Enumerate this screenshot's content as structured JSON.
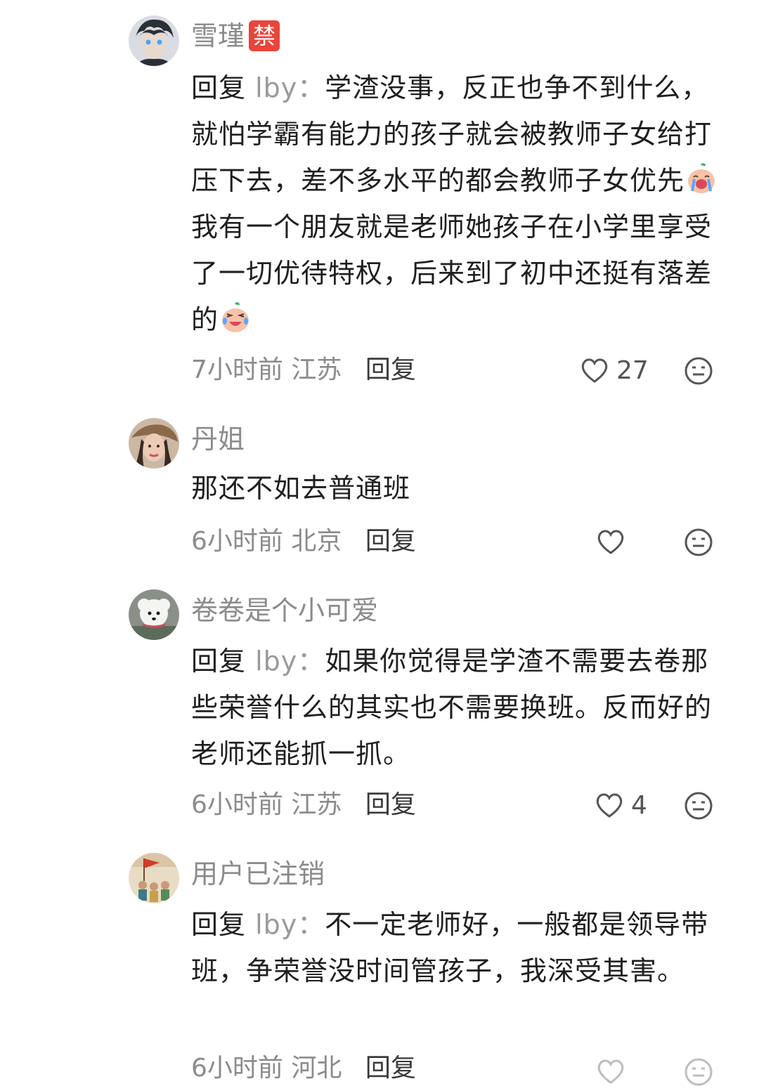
{
  "comments": [
    {
      "username": "雪瑾",
      "badge": "禁",
      "reply_prefix": "回复",
      "reply_target": "lby：",
      "text_a": "学渣没事，反正也争不到什么，就怕学霸有能力的孩子就会被教师子女给打压下去，差不多水平的都会教师子女优先",
      "text_b": "我有一个朋友就是老师她孩子在小学里享受了一切优待特权，后来到了初中还挺有落差的",
      "time": "7小时前",
      "location": "江苏",
      "reply_label": "回复",
      "likes": "27",
      "emojis": [
        "crying-face-icon",
        "laughing-tears-face-icon"
      ]
    },
    {
      "username": "丹姐",
      "text": "那还不如去普通班",
      "time": "6小时前",
      "location": "北京",
      "reply_label": "回复",
      "likes": ""
    },
    {
      "username": "卷卷是个小可爱",
      "reply_prefix": "回复",
      "reply_target": "lby：",
      "text": "如果你觉得是学渣不需要去卷那些荣誉什么的其实也不需要换班。反而好的老师还能抓一抓。",
      "time": "6小时前",
      "location": "江苏",
      "reply_label": "回复",
      "likes": "4"
    },
    {
      "username": "用户已注销",
      "reply_prefix": "回复",
      "reply_target": "lby：",
      "text": "不一定老师好，一般都是领导带班，争荣誉没时间管孩子，我深受其害。",
      "time": "6小时前",
      "location": "河北",
      "reply_label": "回复",
      "likes": ""
    }
  ],
  "colors": {
    "username": "#8b8b8b",
    "body": "#1f1f1f",
    "meta": "#8b8b8b",
    "badge": "#e8453c",
    "icon": "#555555"
  }
}
